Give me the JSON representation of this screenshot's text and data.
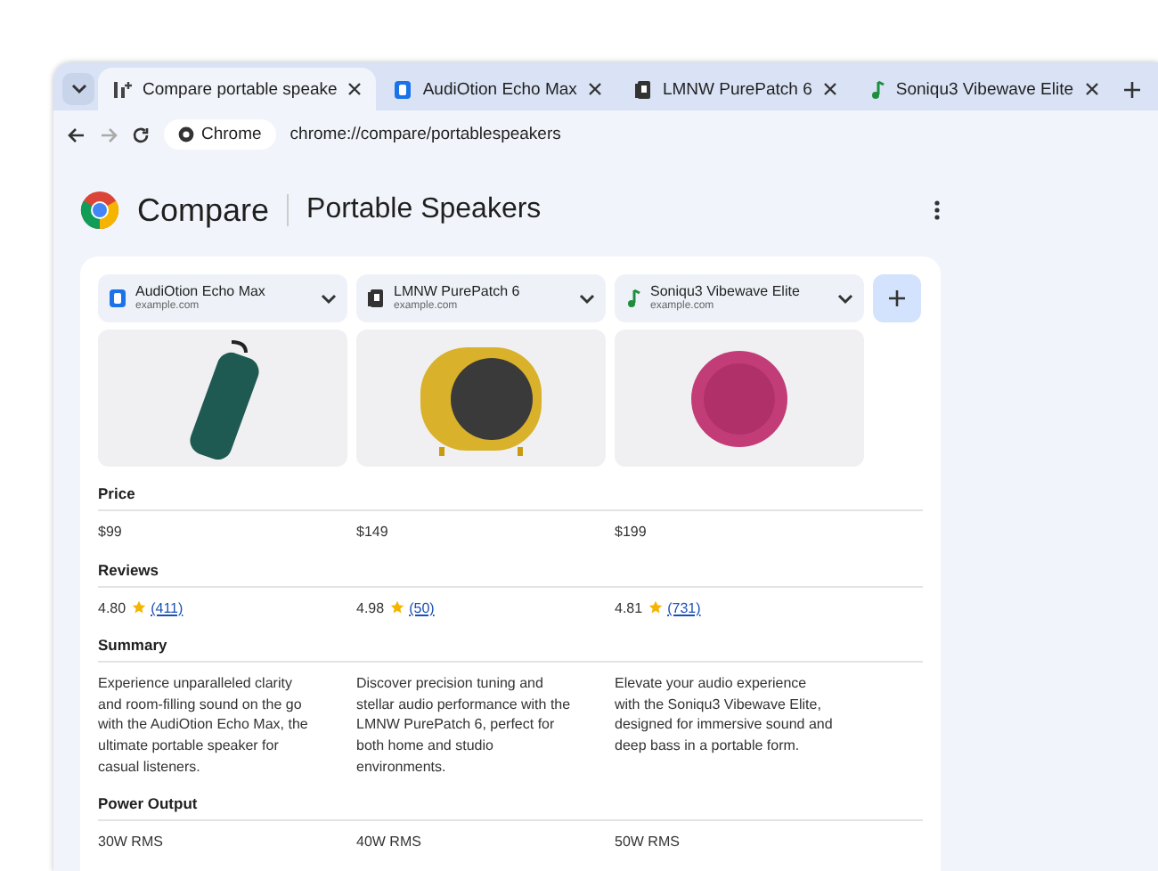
{
  "tabs": [
    {
      "title": "Compare portable speake",
      "selected": true
    },
    {
      "title": "AudiOtion Echo Max",
      "selected": false
    },
    {
      "title": "LMNW PurePatch 6",
      "selected": false
    },
    {
      "title": "Soniqu3 Vibewave Elite",
      "selected": false
    }
  ],
  "toolbar": {
    "chip": "Chrome",
    "url": "chrome://compare/portablespeakers"
  },
  "header": {
    "title": "Compare",
    "subtitle": "Portable Speakers"
  },
  "products": [
    {
      "name": "AudiOtion Echo Max",
      "site": "example.com"
    },
    {
      "name": "LMNW PurePatch 6",
      "site": "example.com"
    },
    {
      "name": "Soniqu3 Vibewave Elite",
      "site": "example.com"
    }
  ],
  "sections": [
    {
      "label": "Price",
      "kind": "text",
      "values": [
        "$99",
        "$149",
        "$199"
      ]
    },
    {
      "label": "Reviews",
      "kind": "rating",
      "values": [
        {
          "rating": "4.80",
          "count": "(411)"
        },
        {
          "rating": "4.98",
          "count": "(50)"
        },
        {
          "rating": "4.81",
          "count": "(731)"
        }
      ]
    },
    {
      "label": "Summary",
      "kind": "text",
      "values": [
        "Experience unparalleled clarity and room-filling sound on the go with the AudiOtion Echo Max, the ultimate portable speaker for casual listeners.",
        "Discover precision tuning and stellar audio performance with the LMNW PurePatch 6, perfect for both home and studio environments.",
        "Elevate your audio experience with the Soniqu3 Vibewave Elite, designed for immersive sound and deep bass in a portable form."
      ]
    },
    {
      "label": "Power Output",
      "kind": "text",
      "values": [
        "30W RMS",
        "40W RMS",
        "50W RMS"
      ]
    }
  ]
}
